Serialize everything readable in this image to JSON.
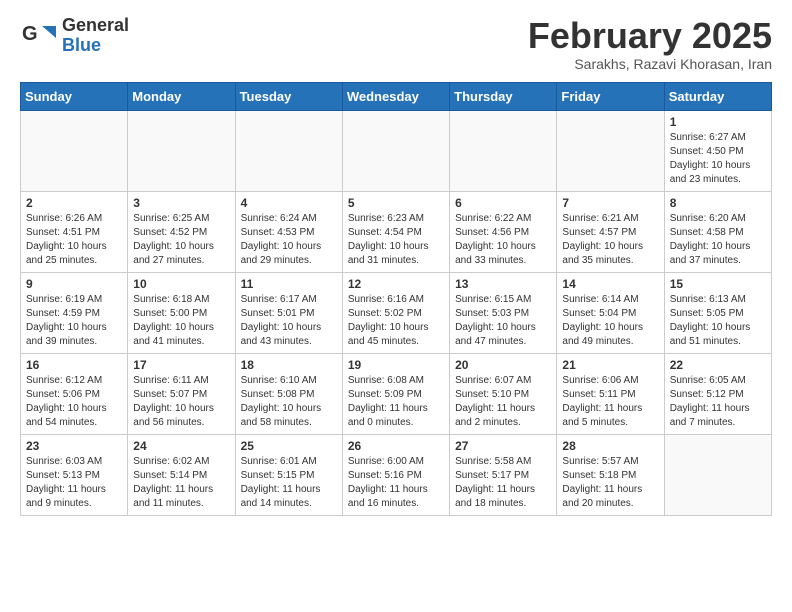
{
  "header": {
    "logo_general": "General",
    "logo_blue": "Blue",
    "month_title": "February 2025",
    "subtitle": "Sarakhs, Razavi Khorasan, Iran"
  },
  "weekdays": [
    "Sunday",
    "Monday",
    "Tuesday",
    "Wednesday",
    "Thursday",
    "Friday",
    "Saturday"
  ],
  "weeks": [
    [
      {
        "day": "",
        "info": ""
      },
      {
        "day": "",
        "info": ""
      },
      {
        "day": "",
        "info": ""
      },
      {
        "day": "",
        "info": ""
      },
      {
        "day": "",
        "info": ""
      },
      {
        "day": "",
        "info": ""
      },
      {
        "day": "1",
        "info": "Sunrise: 6:27 AM\nSunset: 4:50 PM\nDaylight: 10 hours and 23 minutes."
      }
    ],
    [
      {
        "day": "2",
        "info": "Sunrise: 6:26 AM\nSunset: 4:51 PM\nDaylight: 10 hours and 25 minutes."
      },
      {
        "day": "3",
        "info": "Sunrise: 6:25 AM\nSunset: 4:52 PM\nDaylight: 10 hours and 27 minutes."
      },
      {
        "day": "4",
        "info": "Sunrise: 6:24 AM\nSunset: 4:53 PM\nDaylight: 10 hours and 29 minutes."
      },
      {
        "day": "5",
        "info": "Sunrise: 6:23 AM\nSunset: 4:54 PM\nDaylight: 10 hours and 31 minutes."
      },
      {
        "day": "6",
        "info": "Sunrise: 6:22 AM\nSunset: 4:56 PM\nDaylight: 10 hours and 33 minutes."
      },
      {
        "day": "7",
        "info": "Sunrise: 6:21 AM\nSunset: 4:57 PM\nDaylight: 10 hours and 35 minutes."
      },
      {
        "day": "8",
        "info": "Sunrise: 6:20 AM\nSunset: 4:58 PM\nDaylight: 10 hours and 37 minutes."
      }
    ],
    [
      {
        "day": "9",
        "info": "Sunrise: 6:19 AM\nSunset: 4:59 PM\nDaylight: 10 hours and 39 minutes."
      },
      {
        "day": "10",
        "info": "Sunrise: 6:18 AM\nSunset: 5:00 PM\nDaylight: 10 hours and 41 minutes."
      },
      {
        "day": "11",
        "info": "Sunrise: 6:17 AM\nSunset: 5:01 PM\nDaylight: 10 hours and 43 minutes."
      },
      {
        "day": "12",
        "info": "Sunrise: 6:16 AM\nSunset: 5:02 PM\nDaylight: 10 hours and 45 minutes."
      },
      {
        "day": "13",
        "info": "Sunrise: 6:15 AM\nSunset: 5:03 PM\nDaylight: 10 hours and 47 minutes."
      },
      {
        "day": "14",
        "info": "Sunrise: 6:14 AM\nSunset: 5:04 PM\nDaylight: 10 hours and 49 minutes."
      },
      {
        "day": "15",
        "info": "Sunrise: 6:13 AM\nSunset: 5:05 PM\nDaylight: 10 hours and 51 minutes."
      }
    ],
    [
      {
        "day": "16",
        "info": "Sunrise: 6:12 AM\nSunset: 5:06 PM\nDaylight: 10 hours and 54 minutes."
      },
      {
        "day": "17",
        "info": "Sunrise: 6:11 AM\nSunset: 5:07 PM\nDaylight: 10 hours and 56 minutes."
      },
      {
        "day": "18",
        "info": "Sunrise: 6:10 AM\nSunset: 5:08 PM\nDaylight: 10 hours and 58 minutes."
      },
      {
        "day": "19",
        "info": "Sunrise: 6:08 AM\nSunset: 5:09 PM\nDaylight: 11 hours and 0 minutes."
      },
      {
        "day": "20",
        "info": "Sunrise: 6:07 AM\nSunset: 5:10 PM\nDaylight: 11 hours and 2 minutes."
      },
      {
        "day": "21",
        "info": "Sunrise: 6:06 AM\nSunset: 5:11 PM\nDaylight: 11 hours and 5 minutes."
      },
      {
        "day": "22",
        "info": "Sunrise: 6:05 AM\nSunset: 5:12 PM\nDaylight: 11 hours and 7 minutes."
      }
    ],
    [
      {
        "day": "23",
        "info": "Sunrise: 6:03 AM\nSunset: 5:13 PM\nDaylight: 11 hours and 9 minutes."
      },
      {
        "day": "24",
        "info": "Sunrise: 6:02 AM\nSunset: 5:14 PM\nDaylight: 11 hours and 11 minutes."
      },
      {
        "day": "25",
        "info": "Sunrise: 6:01 AM\nSunset: 5:15 PM\nDaylight: 11 hours and 14 minutes."
      },
      {
        "day": "26",
        "info": "Sunrise: 6:00 AM\nSunset: 5:16 PM\nDaylight: 11 hours and 16 minutes."
      },
      {
        "day": "27",
        "info": "Sunrise: 5:58 AM\nSunset: 5:17 PM\nDaylight: 11 hours and 18 minutes."
      },
      {
        "day": "28",
        "info": "Sunrise: 5:57 AM\nSunset: 5:18 PM\nDaylight: 11 hours and 20 minutes."
      },
      {
        "day": "",
        "info": ""
      }
    ]
  ]
}
